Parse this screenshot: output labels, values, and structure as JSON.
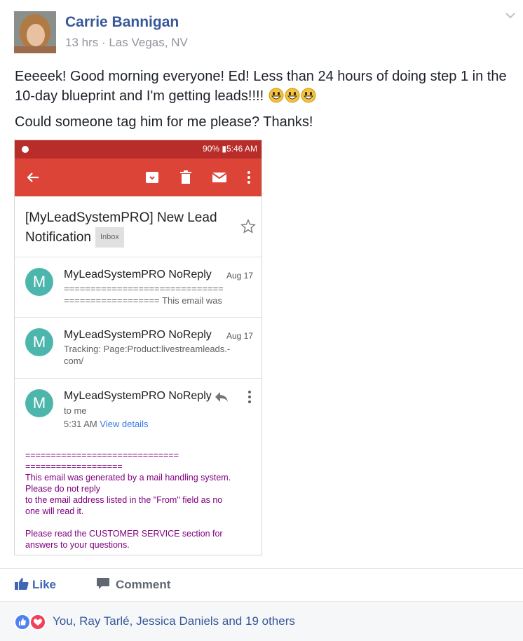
{
  "post": {
    "author": "Carrie Bannigan",
    "meta": "13 hrs · Las Vegas, NV",
    "text_line1": "Eeeeek! Good morning everyone! Ed! Less than 24 hours of doing step 1 in the 10-day blueprint and I'm getting leads!!!!",
    "text_line2": "Could someone tag him for me please? Thanks!"
  },
  "screenshot": {
    "status_bar": "90% ▮5:46 AM",
    "subject": "[MyLeadSystemPRO] New Lead Notification",
    "inbox_label": "Inbox",
    "messages": [
      {
        "initial": "M",
        "sender": "MyLeadSystemPRO NoReply",
        "date": "Aug 17",
        "snippet": "==============================\n================== This email was"
      },
      {
        "initial": "M",
        "sender": "MyLeadSystemPRO NoReply",
        "date": "Aug 17",
        "snippet": "Tracking: Page:Product:livestreamleads.-\ncom/"
      },
      {
        "initial": "M",
        "sender": "MyLeadSystemPRO NoReply",
        "to": "to me",
        "time": "5:31 AM",
        "view_details": "View details"
      }
    ],
    "body": "==============================\n===================\nThis email was generated by a mail handling system.\nPlease do not reply\nto the email address listed in the \"From\" field as no\none will read it.\n\nPlease read the CUSTOMER SERVICE section for\nanswers to your questions.\n=============================="
  },
  "actions": {
    "like": "Like",
    "comment": "Comment"
  },
  "reactions": {
    "text": "You, Ray Tarlé, Jessica Daniels and 19 others"
  },
  "colors": {
    "link_blue": "#365899",
    "gmail_red": "#db4437",
    "avatar_teal": "#4db6ac",
    "body_purple": "#800080"
  },
  "icons": [
    "chevron-down-icon",
    "grinning-emoji-icon",
    "back-arrow-icon",
    "archive-icon",
    "trash-icon",
    "mail-icon",
    "more-vert-icon",
    "star-icon",
    "reply-icon",
    "like-icon",
    "comment-icon",
    "like-reaction-icon",
    "love-reaction-icon"
  ]
}
